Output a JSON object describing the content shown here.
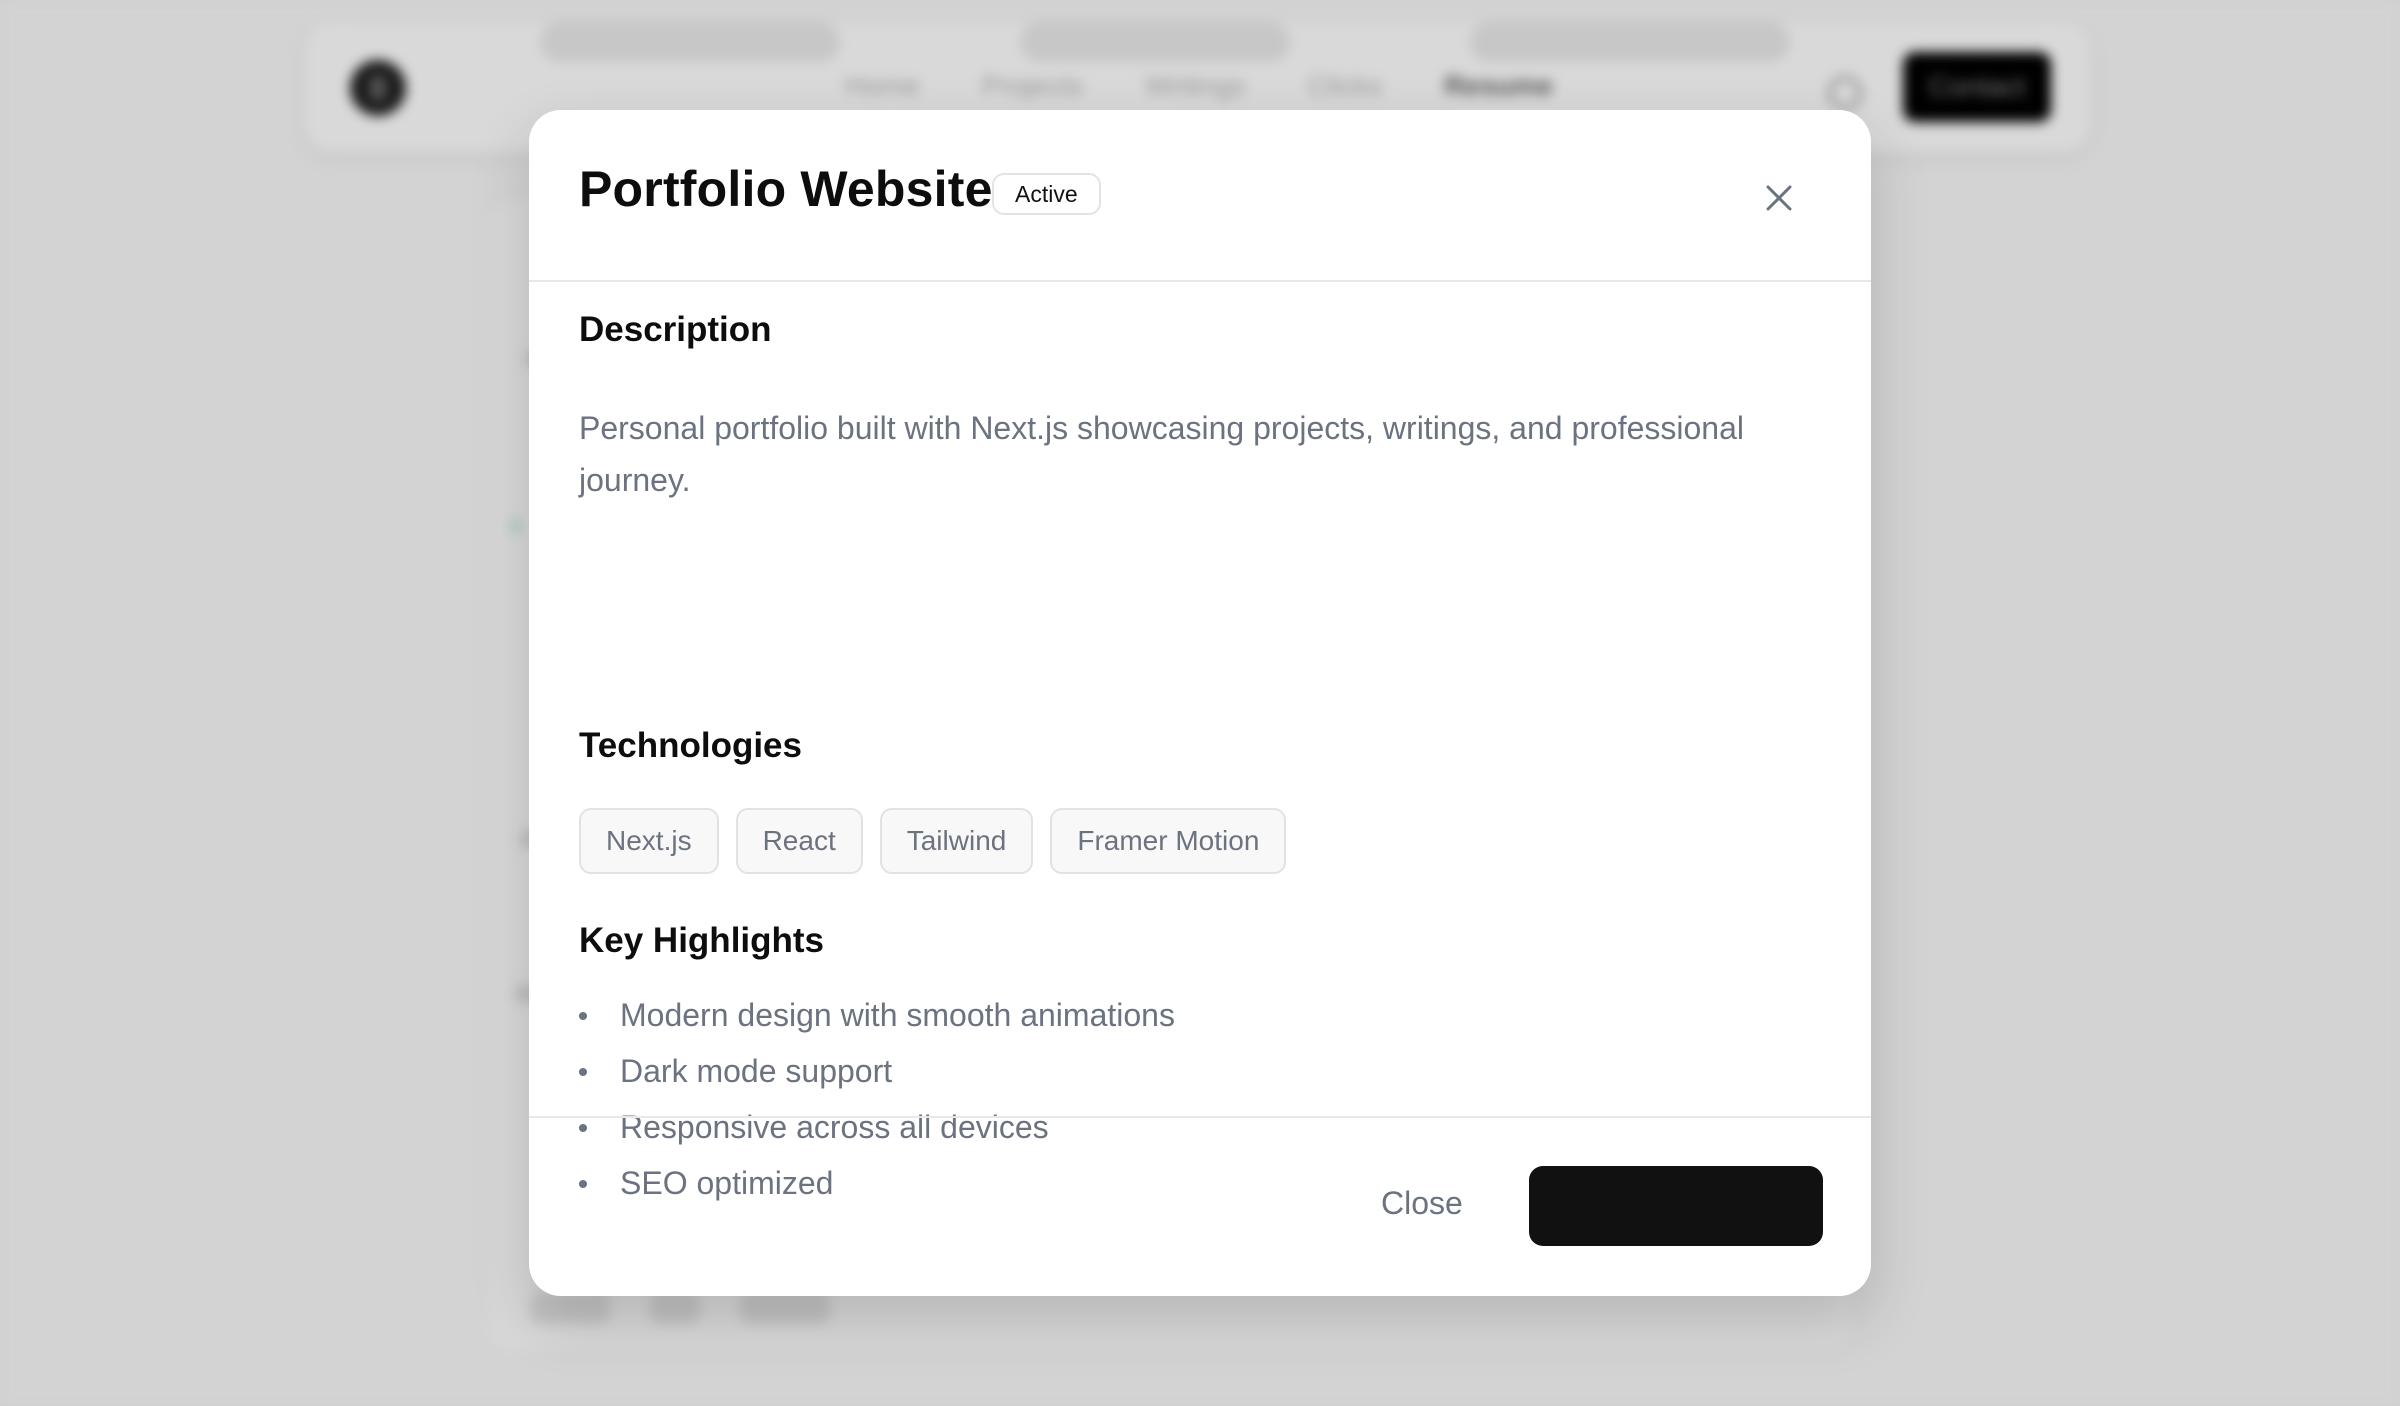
{
  "background": {
    "nav_links": [
      "Home",
      "Projects",
      "Writings",
      "Clicks",
      "Resume"
    ],
    "contact_label": "Contact"
  },
  "modal": {
    "title": "Portfolio Website",
    "status": "Active",
    "close_icon": "close-icon",
    "description_heading": "Description",
    "description": "Personal portfolio built with Next.js showcasing projects, writings, and professional journey.",
    "technologies_heading": "Technologies",
    "technologies": [
      "Next.js",
      "React",
      "Tailwind",
      "Framer Motion"
    ],
    "highlights_heading": "Key Highlights",
    "highlights": [
      "Modern design with smooth animations",
      "Dark mode support",
      "Responsive across all devices",
      "SEO optimized"
    ],
    "footer": {
      "close_label": "Close",
      "primary_label": ""
    }
  },
  "colors": {
    "overlay": "#cfcfcf",
    "modal_bg": "#ffffff",
    "text_primary": "#0d0d0d",
    "text_muted": "#6b7280",
    "primary_button": "#111111"
  }
}
